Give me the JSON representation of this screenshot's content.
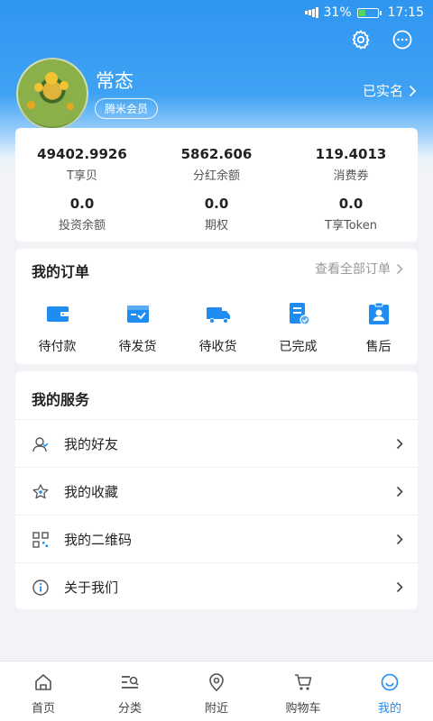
{
  "status_bar": {
    "battery": "31%",
    "time": "17:15",
    "battery_level": 0.31
  },
  "profile": {
    "name": "常态",
    "badge": "腾米会员",
    "verified": "已实名"
  },
  "stats": [
    {
      "value": "49402.9926",
      "label": "T享贝"
    },
    {
      "value": "5862.606",
      "label": "分红余额"
    },
    {
      "value": "119.4013",
      "label": "消费券"
    },
    {
      "value": "0.0",
      "label": "投资余额"
    },
    {
      "value": "0.0",
      "label": "期权"
    },
    {
      "value": "0.0",
      "label": "T享Token"
    }
  ],
  "orders": {
    "title": "我的订单",
    "view_all": "查看全部订单",
    "items": [
      {
        "label": "待付款",
        "icon": "wallet-icon"
      },
      {
        "label": "待发货",
        "icon": "package-icon"
      },
      {
        "label": "待收货",
        "icon": "truck-icon"
      },
      {
        "label": "已完成",
        "icon": "checklist-icon"
      },
      {
        "label": "售后",
        "icon": "service-badge-icon"
      }
    ]
  },
  "services": {
    "title": "我的服务",
    "items": [
      {
        "label": "我的好友",
        "icon": "friends-icon"
      },
      {
        "label": "我的收藏",
        "icon": "star-icon"
      },
      {
        "label": "我的二维码",
        "icon": "qrcode-icon"
      },
      {
        "label": "关于我们",
        "icon": "info-icon"
      }
    ]
  },
  "tabs": [
    {
      "label": "首页",
      "icon": "home-icon"
    },
    {
      "label": "分类",
      "icon": "category-icon"
    },
    {
      "label": "附近",
      "icon": "location-icon"
    },
    {
      "label": "购物车",
      "icon": "cart-icon"
    },
    {
      "label": "我的",
      "icon": "profile-smile-icon",
      "active": true
    }
  ],
  "colors": {
    "primary": "#1e8cf0",
    "header": "#3fa2f4",
    "background": "#f2f3f6"
  }
}
